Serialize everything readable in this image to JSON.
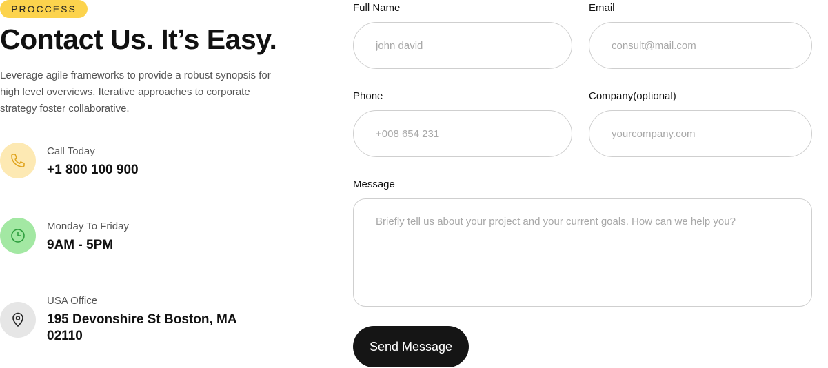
{
  "badge": "PROCCESS",
  "title": "Contact Us. It’s Easy.",
  "lead": "Leverage agile frameworks to provide a robust synopsis for high level overviews. Iterative approaches to corporate strategy foster collaborative.",
  "info": {
    "phone": {
      "label": "Call Today",
      "value": "+1 800 100 900",
      "icon": "phone-icon",
      "color": "#fde9b3"
    },
    "hours": {
      "label": "Monday To Friday",
      "value": "9AM - 5PM",
      "icon": "clock-icon",
      "color": "#a3e8a3"
    },
    "office": {
      "label": "USA Office",
      "value": "195 Devonshire St Boston, MA 02110",
      "icon": "map-pin-icon",
      "color": "#e6e6e6"
    }
  },
  "form": {
    "full_name": {
      "label": "Full Name",
      "placeholder": "john david"
    },
    "email": {
      "label": "Email",
      "placeholder": "consult@mail.com"
    },
    "phone": {
      "label": "Phone",
      "placeholder": "+008 654 231"
    },
    "company": {
      "label": "Company(optional)",
      "placeholder": "yourcompany.com"
    },
    "message": {
      "label": "Message",
      "placeholder": "Briefly tell us about your project and your current goals. How can we help you?"
    },
    "submit_label": "Send Message"
  }
}
